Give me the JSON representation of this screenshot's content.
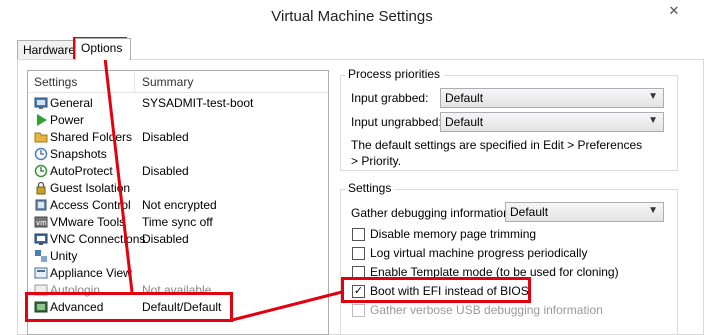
{
  "window": {
    "title": "Virtual Machine Settings",
    "close_glyph": "✕"
  },
  "tabs": [
    {
      "label": "Hardware"
    },
    {
      "label": "Options"
    }
  ],
  "list": {
    "header_settings": "Settings",
    "header_summary": "Summary",
    "items": [
      {
        "label": "General",
        "summary": "SYSADMIT-test-boot",
        "icon": "general-icon"
      },
      {
        "label": "Power",
        "summary": "",
        "icon": "power-icon"
      },
      {
        "label": "Shared Folders",
        "summary": "Disabled",
        "icon": "shared-folders-icon"
      },
      {
        "label": "Snapshots",
        "summary": "",
        "icon": "snapshots-icon"
      },
      {
        "label": "AutoProtect",
        "summary": "Disabled",
        "icon": "autoprotect-icon"
      },
      {
        "label": "Guest Isolation",
        "summary": "",
        "icon": "guest-isolation-icon"
      },
      {
        "label": "Access Control",
        "summary": "Not encrypted",
        "icon": "access-control-icon"
      },
      {
        "label": "VMware Tools",
        "summary": "Time sync off",
        "icon": "vmware-tools-icon"
      },
      {
        "label": "VNC Connections",
        "summary": "Disabled",
        "icon": "vnc-icon"
      },
      {
        "label": "Unity",
        "summary": "",
        "icon": "unity-icon"
      },
      {
        "label": "Appliance View",
        "summary": "",
        "icon": "appliance-view-icon"
      },
      {
        "label": "Autologin",
        "summary": "Not available",
        "icon": "autologin-icon"
      },
      {
        "label": "Advanced",
        "summary": "Default/Default",
        "icon": "advanced-icon"
      }
    ]
  },
  "process_priorities": {
    "title": "Process priorities",
    "input_grabbed_label": "Input grabbed:",
    "input_grabbed_value": "Default",
    "input_ungrabbed_label": "Input ungrabbed:",
    "input_ungrabbed_value": "Default",
    "note": "The default settings are specified in Edit > Preferences > Priority."
  },
  "settings_group": {
    "title": "Settings",
    "gather_label": "Gather debugging information:",
    "gather_value": "Default",
    "checks": [
      {
        "label": "Disable memory page trimming",
        "checked": false,
        "disabled": false
      },
      {
        "label": "Log virtual machine progress periodically",
        "checked": false,
        "disabled": false
      },
      {
        "label": "Enable Template mode (to be used for cloning)",
        "checked": false,
        "disabled": false
      },
      {
        "label": "Boot with EFI instead of BIOS",
        "checked": true,
        "disabled": false
      },
      {
        "label": "Gather verbose USB debugging information",
        "checked": false,
        "disabled": true
      }
    ]
  },
  "colors": {
    "annotation": "#e3000f"
  }
}
